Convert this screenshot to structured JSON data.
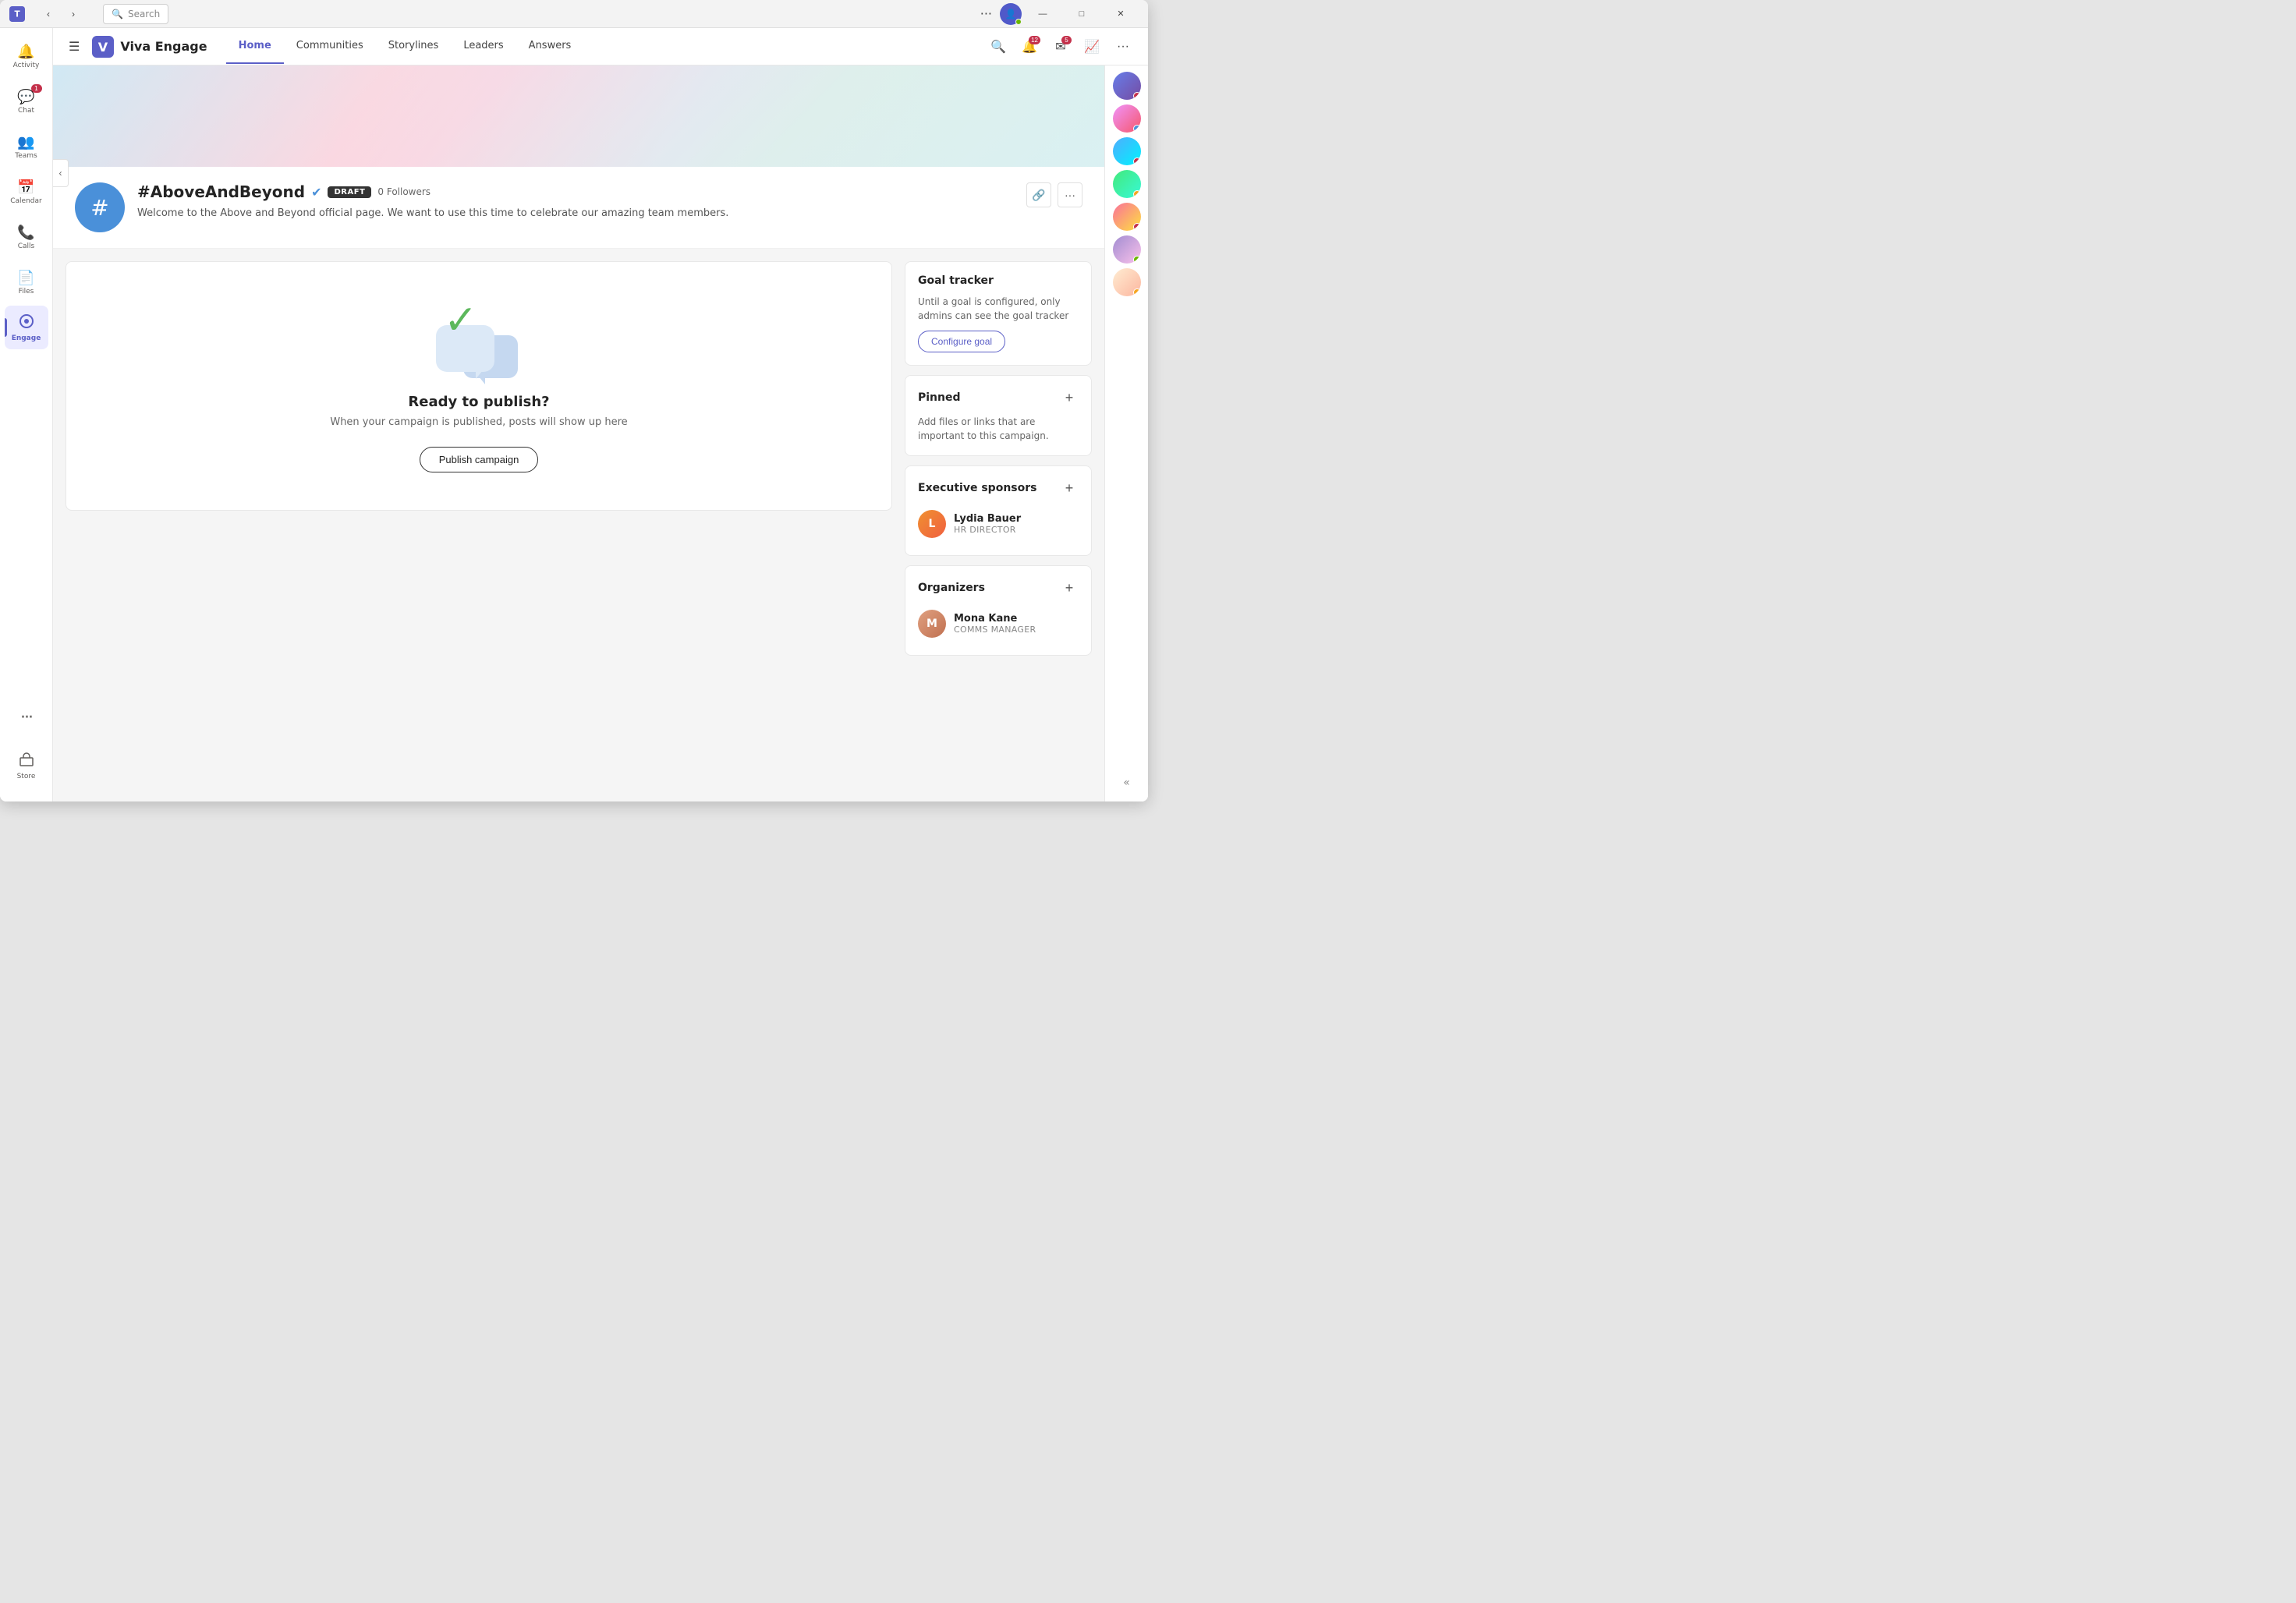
{
  "window": {
    "title": "Viva Engage",
    "search_placeholder": "Search"
  },
  "titlebar": {
    "more_label": "···",
    "minimize_label": "—",
    "maximize_label": "□",
    "close_label": "✕"
  },
  "left_sidebar": {
    "items": [
      {
        "id": "activity",
        "label": "Activity",
        "icon": "🔔",
        "badge": null
      },
      {
        "id": "chat",
        "label": "Chat",
        "icon": "💬",
        "badge": "1"
      },
      {
        "id": "teams",
        "label": "Teams",
        "icon": "👥",
        "badge": null
      },
      {
        "id": "calendar",
        "label": "Calendar",
        "icon": "📅",
        "badge": null
      },
      {
        "id": "calls",
        "label": "Calls",
        "icon": "📞",
        "badge": null
      },
      {
        "id": "files",
        "label": "Files",
        "icon": "📄",
        "badge": null
      },
      {
        "id": "engage",
        "label": "Engage",
        "icon": "⬡",
        "badge": null,
        "active": true
      }
    ],
    "more_label": "···",
    "store_label": "Store"
  },
  "app_header": {
    "app_name": "Viva Engage",
    "nav_items": [
      {
        "id": "home",
        "label": "Home",
        "active": true
      },
      {
        "id": "communities",
        "label": "Communities",
        "active": false
      },
      {
        "id": "storylines",
        "label": "Storylines",
        "active": false
      },
      {
        "id": "leaders",
        "label": "Leaders",
        "active": false
      },
      {
        "id": "answers",
        "label": "Answers",
        "active": false
      }
    ],
    "actions": {
      "search_label": "🔍",
      "notifications_label": "🔔",
      "notifications_badge": "12",
      "mail_label": "✉",
      "mail_badge": "5",
      "chart_label": "📈",
      "more_label": "···"
    }
  },
  "campaign": {
    "title": "#AboveAndBeyond",
    "status": "DRAFT",
    "followers_count": "0 Followers",
    "description": "Welcome to the Above and Beyond official page. We want to use this time to celebrate our amazing team members.",
    "icon_symbol": "#"
  },
  "main_panel": {
    "ready_title": "Ready to publish?",
    "ready_subtitle": "When your campaign is published, posts will show up here",
    "publish_btn": "Publish campaign"
  },
  "goal_tracker": {
    "title": "Goal tracker",
    "description": "Until a goal is configured, only admins can see the goal tracker",
    "configure_btn": "Configure goal"
  },
  "pinned": {
    "title": "Pinned",
    "description": "Add files or links that are important to this campaign."
  },
  "executive_sponsors": {
    "title": "Executive sponsors",
    "person": {
      "name": "Lydia Bauer",
      "role": "HR DIRECTOR"
    }
  },
  "organizers": {
    "title": "Organizers",
    "person": {
      "name": "Mona Kane",
      "role": "COMMS MANAGER"
    }
  },
  "right_panel_avatars": [
    {
      "id": "av1",
      "class": "av1"
    },
    {
      "id": "av2",
      "class": "av2"
    },
    {
      "id": "av3",
      "class": "av3"
    },
    {
      "id": "av4",
      "class": "av4"
    },
    {
      "id": "av5",
      "class": "av5"
    },
    {
      "id": "av6",
      "class": "av6"
    },
    {
      "id": "av7",
      "class": "av7"
    }
  ]
}
